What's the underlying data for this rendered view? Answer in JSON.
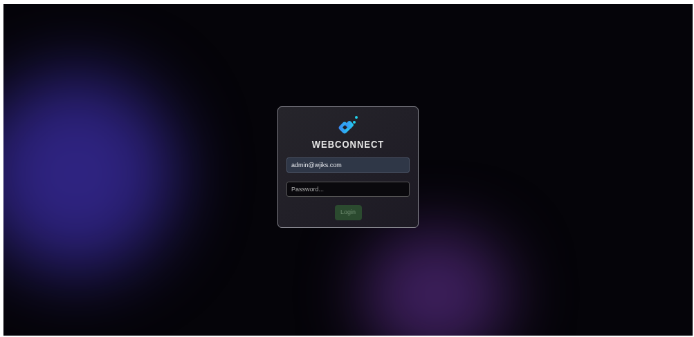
{
  "logo": {
    "text": "WEBCONNECT"
  },
  "email": {
    "value": "admin@wjiks.com"
  },
  "password": {
    "placeholder": "Password..."
  },
  "login_button": {
    "label": "Login",
    "disabled": true
  }
}
